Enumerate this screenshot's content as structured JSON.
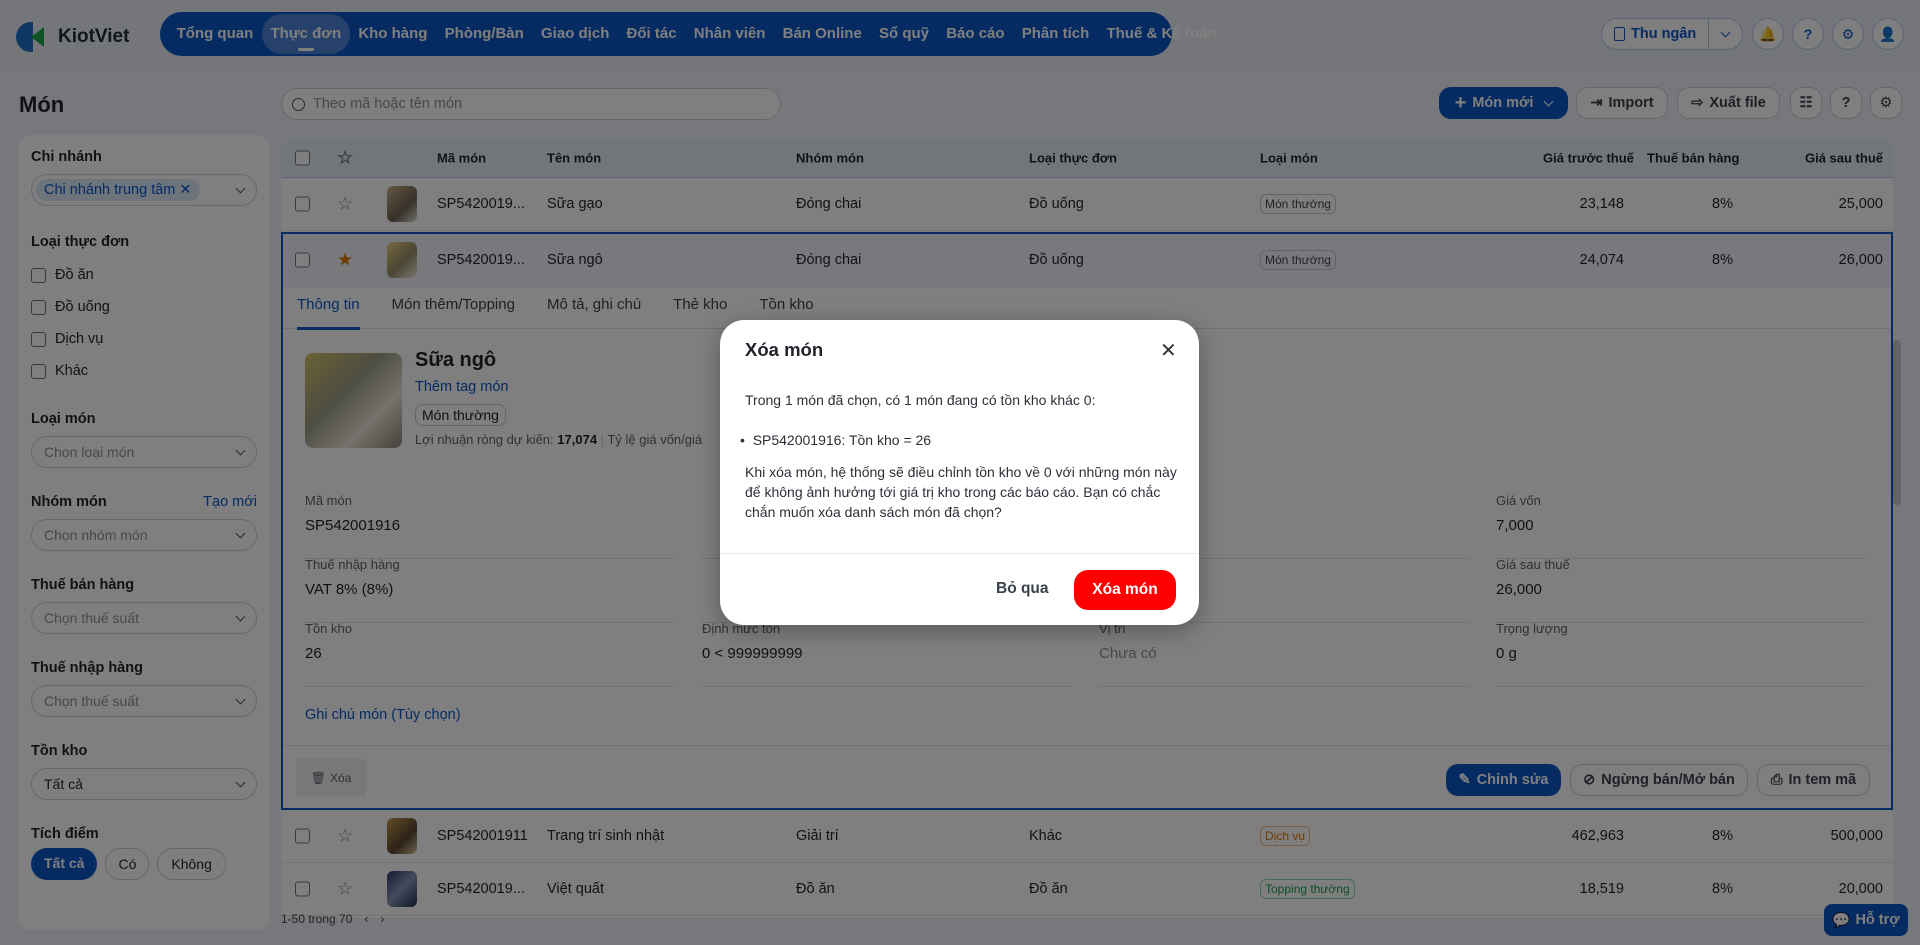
{
  "header": {
    "logo": "KiotViet",
    "nav": [
      "Tổng quan",
      "Thực đơn",
      "Kho hàng",
      "Phòng/Bàn",
      "Giao dịch",
      "Đối tác",
      "Nhân viên",
      "Bán Online",
      "Sổ quỹ",
      "Báo cáo",
      "Phân tích",
      "Thuế & Kế toán"
    ],
    "active_nav": 1,
    "cashier": "Thu ngân"
  },
  "page": {
    "title": "Món"
  },
  "sidebar": {
    "branch_label": "Chi nhánh",
    "branch_tag": "Chi nhánh trung tâm",
    "menu_type_label": "Loại thực đơn",
    "menu_types": [
      "Đồ ăn",
      "Đồ uống",
      "Dịch vụ",
      "Khác"
    ],
    "item_type_label": "Loại món",
    "item_type_placeholder": "Chọn loại món",
    "group_label": "Nhóm món",
    "group_create": "Tạo mới",
    "group_placeholder": "Chọn nhóm món",
    "sales_tax_label": "Thuế bán hàng",
    "sales_tax_placeholder": "Chọn thuế suất",
    "import_tax_label": "Thuế nhập hàng",
    "import_tax_placeholder": "Chọn thuế suất",
    "stock_label": "Tồn kho",
    "stock_value": "Tất cả",
    "points_label": "Tích điểm",
    "points_options": [
      "Tất cả",
      "Có",
      "Không"
    ]
  },
  "toolbar": {
    "search_placeholder": "Theo mã hoặc tên món",
    "new_item": "Món mới",
    "import": "Import",
    "export": "Xuất file"
  },
  "table": {
    "headers": [
      "Mã món",
      "Tên món",
      "Nhóm món",
      "Loại thực đơn",
      "Loại món",
      "Giá trước thuế",
      "Thuế bán hàng",
      "Giá sau thuế"
    ],
    "rows": [
      {
        "code": "SP5420019...",
        "name": "Sữa gạo",
        "group": "Đóng chai",
        "menu_type": "Đồ uống",
        "item_type": "Món thường",
        "pre_tax": "23,148",
        "tax": "8%",
        "post_tax": "25,000",
        "starred": false
      },
      {
        "code": "SP5420019...",
        "name": "Sữa ngô",
        "group": "Đóng chai",
        "menu_type": "Đồ uống",
        "item_type": "Món thường",
        "pre_tax": "24,074",
        "tax": "8%",
        "post_tax": "26,000",
        "starred": true
      },
      {
        "code": "SP542001911",
        "name": "Trang trí sinh nhật",
        "group": "Giải trí",
        "menu_type": "Khác",
        "item_type": "Dịch vụ",
        "pre_tax": "462,963",
        "tax": "8%",
        "post_tax": "500,000",
        "starred": false
      },
      {
        "code": "SP5420019...",
        "name": "Việt quất",
        "group": "Đồ ăn",
        "menu_type": "Đồ ăn",
        "item_type": "Topping thường",
        "pre_tax": "18,519",
        "tax": "8%",
        "post_tax": "20,000",
        "starred": false
      }
    ]
  },
  "detail": {
    "tabs": [
      "Thông tin",
      "Món thêm/Topping",
      "Mô tả, ghi chú",
      "Thẻ kho",
      "Tồn kho"
    ],
    "name": "Sữa ngô",
    "add_tag": "Thêm tag món",
    "type_badge": "Món thường",
    "profit_label": "Lợi nhuận ròng dự kiến:",
    "profit_value": "17,074",
    "ratio_label": "Tỷ lệ giá vốn/giá",
    "fields": {
      "code_label": "Mã món",
      "code": "SP542001916",
      "import_tax_label": "Thuế nhập hàng",
      "import_tax": "VAT 8% (8%)",
      "stock_label": "Tồn kho",
      "stock": "26",
      "min_label": "Định mức tồn",
      "min": "0 < 999999999",
      "location_label": "Vị trí",
      "location": "Chưa có",
      "cost_label": "Giá vốn",
      "cost": "7,000",
      "post_tax_label": "Giá sau thuế",
      "post_tax": "26,000",
      "weight_label": "Trọng lượng",
      "weight": "0 g"
    },
    "note_link": "Ghi chú món (Tùy chọn)",
    "delete": "Xóa",
    "edit": "Chỉnh sửa",
    "toggle_sale": "Ngừng bán/Mở bán",
    "print": "In tem mã"
  },
  "pagination": {
    "text": "1-50 trong 70"
  },
  "support": "Hỗ trợ",
  "modal": {
    "title": "Xóa món",
    "line1": "Trong 1 món đã chọn, có 1 món đang có tồn kho khác 0:",
    "bullet": "SP542001916: Tồn kho = 26",
    "body": "Khi xóa món, hệ thống sẽ điều chỉnh tồn kho về 0 với những món này để không ảnh hưởng tới giá trị kho trong các báo cáo. Bạn có chắc chắn muốn xóa danh sách món đã chọn?",
    "cancel": "Bỏ qua",
    "confirm": "Xóa món"
  },
  "colors": {
    "brand": "#0b57c4",
    "danger": "#ff0000"
  }
}
